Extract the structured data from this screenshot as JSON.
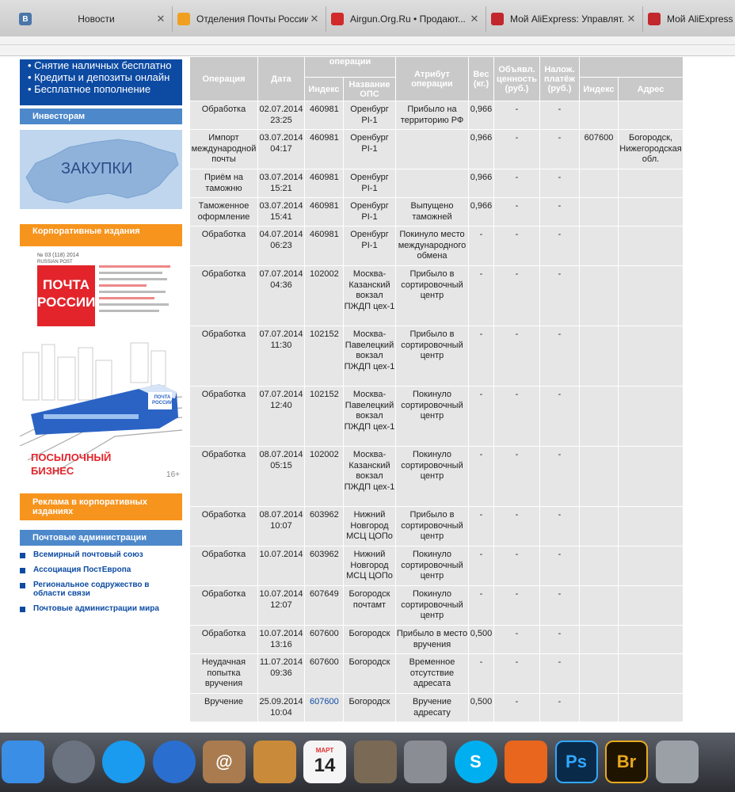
{
  "tabs": [
    {
      "title": "Новости",
      "favicon": "vk-icon",
      "icon_text": "B",
      "color": "#4a76a8"
    },
    {
      "title": "Отделения Почты России...",
      "favicon": "post-icon",
      "icon_text": "",
      "color": "#f0a020"
    },
    {
      "title": "Airgun.Org.Ru • Продают...",
      "favicon": "airgun-icon",
      "icon_text": "",
      "color": "#d12a2a"
    },
    {
      "title": "Мой AliExpress: Управлят...",
      "favicon": "cart-icon",
      "icon_text": "",
      "color": "#c1272d"
    },
    {
      "title": "Мой AliExpress",
      "favicon": "cart-icon",
      "icon_text": "",
      "color": "#c1272d"
    }
  ],
  "sidebar": {
    "promo_lines": [
      "• Снятие наличных бесплатно",
      "• Кредиты и депозиты онлайн",
      "• Бесплатное пополнение"
    ],
    "investors": "Инвесторам",
    "map_label": "ЗАКУПКИ",
    "corporate": "Корпоративные издания",
    "magazine_issue": "№ 03 (118) 2014",
    "magazine_brand": "RUSSIAN POST",
    "magazine_title_1": "ПОЧТА",
    "magazine_title_2": "РОССИИ",
    "train_logo": "ПОЧТА РОССИИ",
    "train_title_1": "ПОСЫЛОЧНЫЙ",
    "train_title_2": "БИЗНЕС",
    "train_age": "16+",
    "ads": "Реклама в корпоративных изданиях",
    "admin": "Почтовые администрации",
    "admin_items": [
      "Всемирный почтовый союз",
      "Ассоциация ПостЕвропа",
      "Региональное содружество в области связи",
      "Почтовые администрации мира"
    ]
  },
  "table": {
    "headers": {
      "operation": "Операция",
      "date": "Дата",
      "place": "операции",
      "index": "Индекс",
      "ops_name": "Название ОПС",
      "attribute": "Атрибут операции",
      "weight": "Вес (кг.)",
      "declared": "Объявл. ценность (руб.)",
      "cod": "Налож. платёж (руб.)",
      "dest_index": "Индекс",
      "dest_address": "Адрес"
    },
    "rows": [
      {
        "op": "Обработка",
        "date": "02.07.2014 23:25",
        "idx": "460981",
        "name": "Оренбург PI-1",
        "attr": "Прибыло на территорию РФ",
        "weight": "0,966",
        "declared": "-",
        "cod": "-",
        "dest_idx": "",
        "dest_addr": ""
      },
      {
        "op": "Импорт международной почты",
        "date": "03.07.2014 04:17",
        "idx": "460981",
        "name": "Оренбург PI-1",
        "attr": "",
        "weight": "0,966",
        "declared": "-",
        "cod": "-",
        "dest_idx": "607600",
        "dest_addr": "Богородск, Нижегородская обл."
      },
      {
        "op": "Приём на таможню",
        "date": "03.07.2014 15:21",
        "idx": "460981",
        "name": "Оренбург PI-1",
        "attr": "",
        "weight": "0,966",
        "declared": "-",
        "cod": "-",
        "dest_idx": "",
        "dest_addr": ""
      },
      {
        "op": "Таможенное оформление",
        "date": "03.07.2014 15:41",
        "idx": "460981",
        "name": "Оренбург PI-1",
        "attr": "Выпущено таможней",
        "weight": "0,966",
        "declared": "-",
        "cod": "-",
        "dest_idx": "",
        "dest_addr": ""
      },
      {
        "op": "Обработка",
        "date": "04.07.2014 06:23",
        "idx": "460981",
        "name": "Оренбург PI-1",
        "attr": "Покинуло место международного обмена",
        "weight": "-",
        "declared": "-",
        "cod": "-",
        "dest_idx": "",
        "dest_addr": ""
      },
      {
        "op": "Обработка",
        "date": "07.07.2014 04:36",
        "idx": "102002",
        "name": "Москва-Казанский вокзал ПЖДП цех-1",
        "attr": "Прибыло в сортировочный центр",
        "weight": "-",
        "declared": "-",
        "cod": "-",
        "dest_idx": "",
        "dest_addr": ""
      },
      {
        "op": "Обработка",
        "date": "07.07.2014 11:30",
        "idx": "102152",
        "name": "Москва-Павелецкий вокзал ПЖДП цех-1",
        "attr": "Прибыло в сортировочный центр",
        "weight": "-",
        "declared": "-",
        "cod": "-",
        "dest_idx": "",
        "dest_addr": ""
      },
      {
        "op": "Обработка",
        "date": "07.07.2014 12:40",
        "idx": "102152",
        "name": "Москва-Павелецкий вокзал ПЖДП цех-1",
        "attr": "Покинуло сортировочный центр",
        "weight": "-",
        "declared": "-",
        "cod": "-",
        "dest_idx": "",
        "dest_addr": ""
      },
      {
        "op": "Обработка",
        "date": "08.07.2014 05:15",
        "idx": "102002",
        "name": "Москва-Казанский вокзал ПЖДП цех-1",
        "attr": "Покинуло сортировочный центр",
        "weight": "-",
        "declared": "-",
        "cod": "-",
        "dest_idx": "",
        "dest_addr": ""
      },
      {
        "op": "Обработка",
        "date": "08.07.2014 10:07",
        "idx": "603962",
        "name": "Нижний Новгород МСЦ ЦОПо",
        "attr": "Прибыло в сортировочный центр",
        "weight": "-",
        "declared": "-",
        "cod": "-",
        "dest_idx": "",
        "dest_addr": ""
      },
      {
        "op": "Обработка",
        "date": "10.07.2014",
        "idx": "603962",
        "name": "Нижний Новгород МСЦ ЦОПо",
        "attr": "Покинуло сортировочный центр",
        "weight": "-",
        "declared": "-",
        "cod": "-",
        "dest_idx": "",
        "dest_addr": ""
      },
      {
        "op": "Обработка",
        "date": "10.07.2014 12:07",
        "idx": "607649",
        "name": "Богородск почтамт",
        "attr": "Покинуло сортировочный центр",
        "weight": "-",
        "declared": "-",
        "cod": "-",
        "dest_idx": "",
        "dest_addr": ""
      },
      {
        "op": "Обработка",
        "date": "10.07.2014 13:16",
        "idx": "607600",
        "name": "Богородск",
        "attr": "Прибыло в место вручения",
        "weight": "0,500",
        "declared": "-",
        "cod": "-",
        "dest_idx": "",
        "dest_addr": ""
      },
      {
        "op": "Неудачная попытка вручения",
        "date": "11.07.2014 09:36",
        "idx": "607600",
        "name": "Богородск",
        "attr": "Временное отсутствие адресата",
        "weight": "-",
        "declared": "-",
        "cod": "-",
        "dest_idx": "",
        "dest_addr": ""
      },
      {
        "op": "Вручение",
        "date": "25.09.2014 10:04",
        "idx": "607600",
        "name": "Богородск",
        "attr": "Вручение адресату",
        "weight": "0,500",
        "declared": "-",
        "cod": "-",
        "dest_idx": "",
        "dest_addr": ""
      }
    ]
  },
  "dock": {
    "icons": [
      {
        "name": "finder-icon",
        "label": "",
        "color": "#3a8ee6"
      },
      {
        "name": "launchpad-icon",
        "label": "",
        "color": "#6b7280"
      },
      {
        "name": "app-store-icon",
        "label": "",
        "color": "#1a9bf0"
      },
      {
        "name": "quicktime-icon",
        "label": "",
        "color": "#2a6fd0"
      },
      {
        "name": "address-book-icon",
        "label": "@",
        "color": "#a97b4f"
      },
      {
        "name": "garageband-icon",
        "label": "",
        "color": "#c98a3a"
      },
      {
        "name": "calendar-icon",
        "label": "14",
        "color": "#f5f5f5"
      },
      {
        "name": "iphoto-icon",
        "label": "",
        "color": "#7a6a55"
      },
      {
        "name": "system-preferences-icon",
        "label": "",
        "color": "#8a8d93"
      },
      {
        "name": "skype-icon",
        "label": "S",
        "color": "#00aff0"
      },
      {
        "name": "firefox-icon",
        "label": "",
        "color": "#e8661e"
      },
      {
        "name": "photoshop-icon",
        "label": "Ps",
        "color": "#0a2a4a"
      },
      {
        "name": "bridge-icon",
        "label": "Br",
        "color": "#1f1400"
      },
      {
        "name": "trash-icon",
        "label": "",
        "color": "#9aa0a6"
      }
    ],
    "calendar_month": "МАРТ"
  }
}
